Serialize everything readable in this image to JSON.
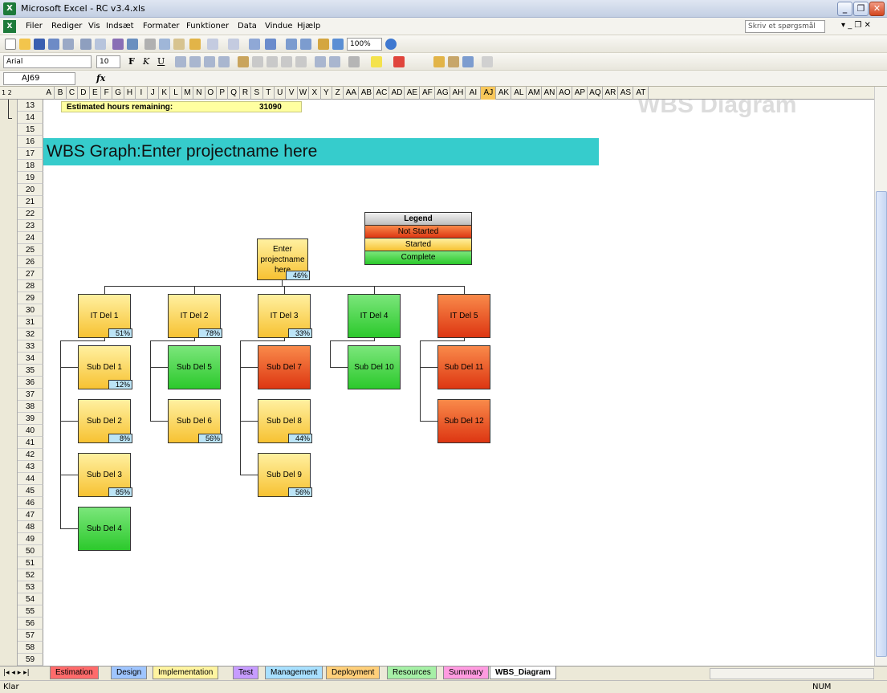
{
  "window": {
    "title": "Microsoft Excel - RC v3.4.xls",
    "icon": "X"
  },
  "menus": [
    "Filer",
    "Rediger",
    "Vis",
    "Indsæt",
    "Formater",
    "Funktioner",
    "Data",
    "Vindue",
    "Hjælp"
  ],
  "help_placeholder": "Skriv et spørgsmål",
  "toolbar": {
    "zoom": "100%",
    "font": "Arial",
    "size": "10"
  },
  "formula": {
    "cell": "AJ69",
    "fx": "fx"
  },
  "columns": [
    "A",
    "B",
    "C",
    "D",
    "E",
    "F",
    "G",
    "H",
    "I",
    "J",
    "K",
    "L",
    "M",
    "N",
    "O",
    "P",
    "Q",
    "R",
    "S",
    "T",
    "U",
    "V",
    "W",
    "X",
    "Y",
    "Z",
    "AA",
    "AB",
    "AC",
    "AD",
    "AE",
    "AF",
    "AG",
    "AH",
    "AI",
    "AJ",
    "AK",
    "AL",
    "AM",
    "AN",
    "AO",
    "AP",
    "AQ",
    "AR",
    "AS",
    "AT"
  ],
  "rows": [
    "13",
    "14",
    "15",
    "16",
    "17",
    "18",
    "19",
    "20",
    "21",
    "22",
    "23",
    "24",
    "25",
    "26",
    "27",
    "28",
    "29",
    "30",
    "31",
    "32",
    "33",
    "34",
    "35",
    "36",
    "37",
    "38",
    "39",
    "40",
    "41",
    "42",
    "43",
    "44",
    "45",
    "46",
    "47",
    "48",
    "49",
    "50",
    "51",
    "52",
    "53",
    "54",
    "55",
    "56",
    "57",
    "58",
    "59"
  ],
  "estimate": {
    "label": "Estimated hours remaining:",
    "value": "31090"
  },
  "banner": "WBS Graph:Enter projectname here",
  "watermark": "WBS Diagram",
  "legend": {
    "title": "Legend",
    "not_started": "Not Started",
    "started": "Started",
    "complete": "Complete"
  },
  "colors": {
    "not_started": "#dd3612",
    "started": "#f7c232",
    "complete": "#2cc92c",
    "banner": "#36cccc"
  },
  "root": {
    "label": "Enter projectname here",
    "pct": "46%"
  },
  "deliverables": [
    {
      "label": "IT Del 1",
      "pct": "51%",
      "status": "started"
    },
    {
      "label": "IT Del 2",
      "pct": "78%",
      "status": "started"
    },
    {
      "label": "IT Del 3",
      "pct": "33%",
      "status": "started"
    },
    {
      "label": "IT Del 4",
      "pct": "",
      "status": "complete"
    },
    {
      "label": "IT Del 5",
      "pct": "",
      "status": "notstarted"
    }
  ],
  "subs": [
    {
      "label": "Sub Del 1",
      "pct": "12%",
      "status": "started"
    },
    {
      "label": "Sub Del 2",
      "pct": "8%",
      "status": "started"
    },
    {
      "label": "Sub Del 3",
      "pct": "85%",
      "status": "started"
    },
    {
      "label": "Sub Del 4",
      "pct": "",
      "status": "complete"
    },
    {
      "label": "Sub Del 5",
      "pct": "",
      "status": "complete"
    },
    {
      "label": "Sub Del 6",
      "pct": "56%",
      "status": "started"
    },
    {
      "label": "Sub Del 7",
      "pct": "",
      "status": "notstarted"
    },
    {
      "label": "Sub Del 8",
      "pct": "44%",
      "status": "started"
    },
    {
      "label": "Sub Del 9",
      "pct": "56%",
      "status": "started"
    },
    {
      "label": "Sub Del 10",
      "pct": "",
      "status": "complete"
    },
    {
      "label": "Sub Del 11",
      "pct": "",
      "status": "notstarted"
    },
    {
      "label": "Sub Del 12",
      "pct": "",
      "status": "notstarted"
    }
  ],
  "tabs": [
    "Estimation",
    "Design",
    "Implementation",
    "Test",
    "Management",
    "Deployment",
    "Resources",
    "Summary",
    "WBS_Diagram"
  ],
  "status": {
    "left": "Klar",
    "right": "NUM"
  }
}
